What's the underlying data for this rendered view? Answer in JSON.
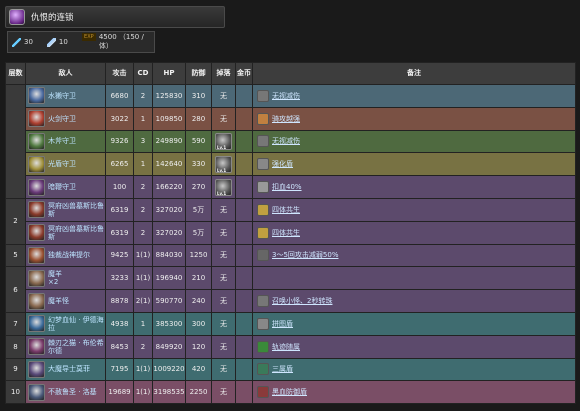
{
  "header": {
    "title": "仇恨的连锁"
  },
  "stats": {
    "attack": "30",
    "crystals": "10",
    "exp": "4500 （150 / 体）"
  },
  "table": {
    "headers": {
      "layer": "层数",
      "enemy": "敌人",
      "attack": "攻击",
      "cd": "CD",
      "hp": "HP",
      "defense": "防御",
      "drop": "掉落",
      "gold": "金币",
      "note": "备注"
    },
    "rows": [
      {
        "layer": "",
        "enemy": "水獭守卫",
        "attack": "6680",
        "cd": "2",
        "hp": "125830",
        "defense": "310",
        "drop": "无",
        "note": "无视减伤",
        "color": "c-blue",
        "av": "#4a6aa0",
        "ni": "#777"
      },
      {
        "layer": "",
        "enemy": "火剑守卫",
        "attack": "3022",
        "cd": "1",
        "hp": "109850",
        "defense": "280",
        "drop": "无",
        "note": "骑攻越强",
        "color": "c-brown",
        "av": "#b04030",
        "ni": "#c08040"
      },
      {
        "layer": "",
        "enemy": "木斧守卫",
        "attack": "9326",
        "cd": "3",
        "hp": "249890",
        "defense": "590",
        "drop": "",
        "dropLv": "Lv.1",
        "note": "无视减伤",
        "color": "c-green",
        "av": "#507a40",
        "ni": "#777"
      },
      {
        "layer": "",
        "enemy": "光盾守卫",
        "attack": "6265",
        "cd": "1",
        "hp": "142640",
        "defense": "330",
        "drop": "",
        "dropLv": "Lv.1",
        "note": "强化盾",
        "color": "c-olive",
        "av": "#a0903a",
        "ni": "#888"
      },
      {
        "layer": "",
        "enemy": "暗鞭守卫",
        "attack": "100",
        "cd": "2",
        "hp": "166220",
        "defense": "270",
        "drop": "",
        "dropLv": "Lv.1",
        "note": "扣血40%",
        "color": "c-purple",
        "av": "#6a3a7a",
        "ni": "#999"
      },
      {
        "layer": "2",
        "enemy": "冥府凶兽墓斯比鲁斯",
        "attack": "6319",
        "cd": "2",
        "hp": "327020",
        "defense": "5万",
        "drop": "无",
        "note": "四体共生",
        "color": "c-purple",
        "av": "#8a3a2a",
        "ni": "#c0a040"
      },
      {
        "layer": "",
        "enemy": "冥府凶兽墓斯比鲁斯",
        "attack": "6319",
        "cd": "2",
        "hp": "327020",
        "defense": "5万",
        "drop": "无",
        "note": "四体共生",
        "color": "c-purple",
        "av": "#8a3a2a",
        "ni": "#c0a040"
      },
      {
        "layer": "5",
        "enemy": "独裁战神提尔",
        "attack": "9425",
        "cd": "1(1)",
        "hp": "884030",
        "defense": "1250",
        "drop": "无",
        "note": "3～5回攻击减弱50%",
        "color": "c-purple",
        "av": "#9a5030",
        "ni": "#666"
      },
      {
        "layer": "6",
        "enemy": "魔羊\n×2",
        "attack": "3233",
        "cd": "1(1)",
        "hp": "196940",
        "defense": "210",
        "drop": "无",
        "note": "",
        "color": "c-purple",
        "av": "#8a6a50",
        "ni": ""
      },
      {
        "layer": "",
        "enemy": "魔羊怪",
        "attack": "8878",
        "cd": "2(1)",
        "hp": "590770",
        "defense": "240",
        "drop": "无",
        "note": "召唤小怪、2秒转珠",
        "color": "c-purple",
        "av": "#8a6a50",
        "ni": "#777"
      },
      {
        "layer": "7",
        "enemy": "幻梦血仙 · 伊德海拉",
        "attack": "4938",
        "cd": "1",
        "hp": "385300",
        "defense": "300",
        "drop": "无",
        "note": "拼图盾",
        "color": "c-teal",
        "av": "#3a6a9a",
        "ni": "#888"
      },
      {
        "layer": "8",
        "enemy": "棘刃之猫 · 布伦希尔德",
        "attack": "8453",
        "cd": "2",
        "hp": "849920",
        "defense": "120",
        "drop": "无",
        "note": "轨迹随属",
        "color": "c-purple",
        "av": "#7a3a6a",
        "ni": "#3a8a3a"
      },
      {
        "layer": "9",
        "enemy": "大魔导士莫菲",
        "attack": "7195",
        "cd": "1(1)",
        "hp": "1009220",
        "defense": "420",
        "drop": "无",
        "note": "三属盾",
        "color": "c-teal",
        "av": "#5a4a7a",
        "ni": "#3a7a5a"
      },
      {
        "layer": "10",
        "enemy": "不赦鲁圣 · 洛基",
        "attack": "19689",
        "cd": "1(1)",
        "hp": "3198535",
        "defense": "2250",
        "drop": "无",
        "note": "黑血防御盾",
        "color": "c-pink",
        "av": "#4a5a7a",
        "ni": "#8a3a3a"
      }
    ]
  }
}
